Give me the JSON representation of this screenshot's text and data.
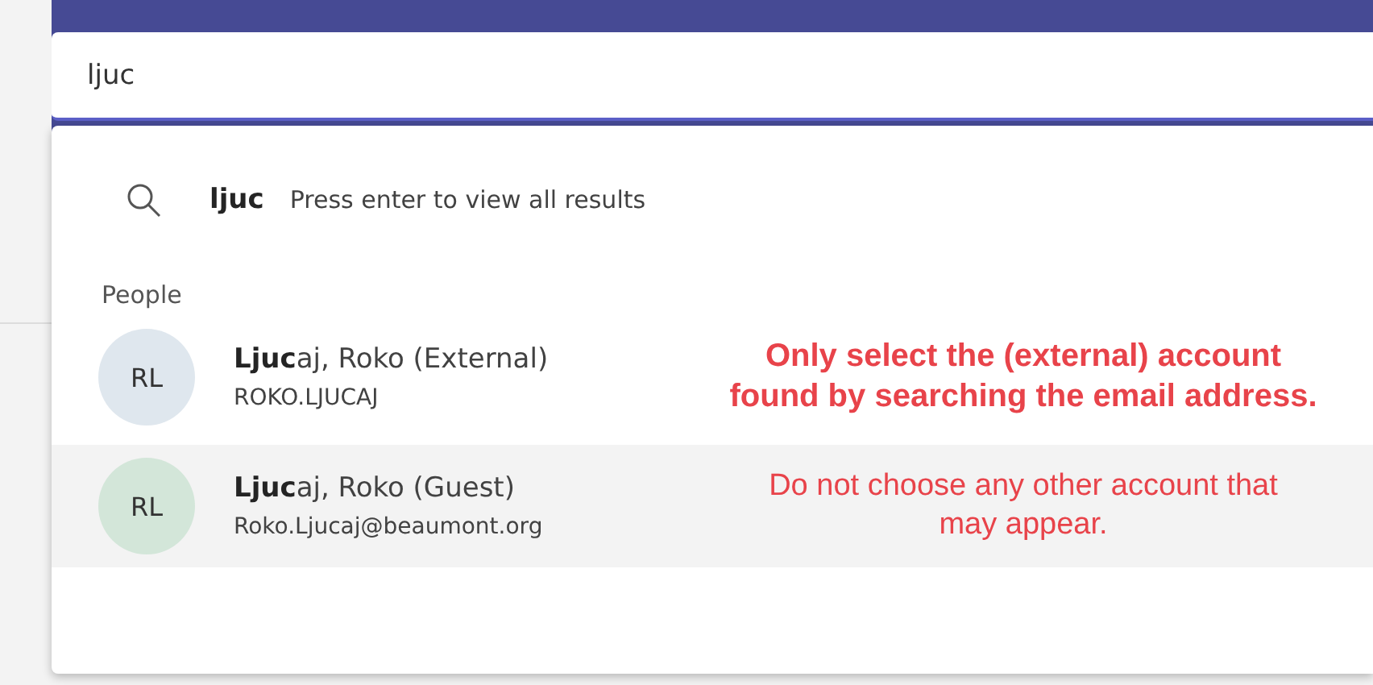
{
  "search": {
    "value": "ljuc"
  },
  "suggestion": {
    "query": "ljuc",
    "hint": "Press enter to view all results"
  },
  "section": "People",
  "people": [
    {
      "initials": "RL",
      "name": "**Ljuc**aj, Roko (External)",
      "detail": "ROKO.LJUCAJ",
      "color": "#dfe7ee",
      "selected": false,
      "note": "Only select the (external) account found by searching the email address.",
      "kind": "bold"
    },
    {
      "initials": "RL",
      "name": "**Ljuc**aj, Roko (Guest)",
      "detail": "Roko.Ljucaj@beaumont.org",
      "color": "#d3e6d9",
      "selected": true,
      "note": "Do not choose any other account that may appear.",
      "kind": "plain"
    }
  ]
}
